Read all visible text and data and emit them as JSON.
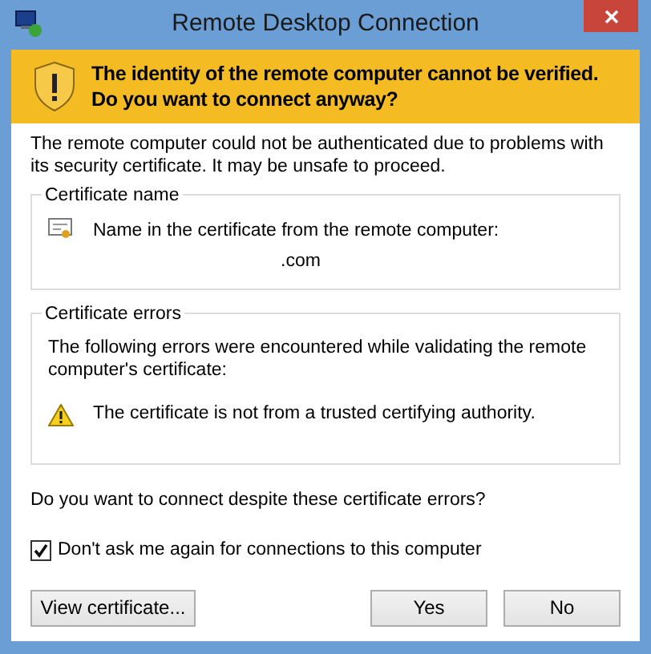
{
  "window": {
    "title": "Remote Desktop Connection"
  },
  "banner": "The identity of the remote computer cannot be verified. Do you want to connect anyway?",
  "intro": "The remote computer could not be authenticated due to problems with its security certificate. It may be unsafe to proceed.",
  "certificate_name": {
    "title": "Certificate name",
    "label": "Name in the certificate from the remote computer:",
    "value": ".com"
  },
  "certificate_errors": {
    "title": "Certificate errors",
    "description": "The following errors were encountered while validating the remote computer's certificate:",
    "errors": [
      "The certificate is not from a trusted certifying authority."
    ]
  },
  "question": "Do you want to connect despite these certificate errors?",
  "dont_ask": {
    "label": "Don't ask me again for connections to this computer",
    "checked": true
  },
  "buttons": {
    "view": "View certificate...",
    "yes": "Yes",
    "no": "No"
  }
}
